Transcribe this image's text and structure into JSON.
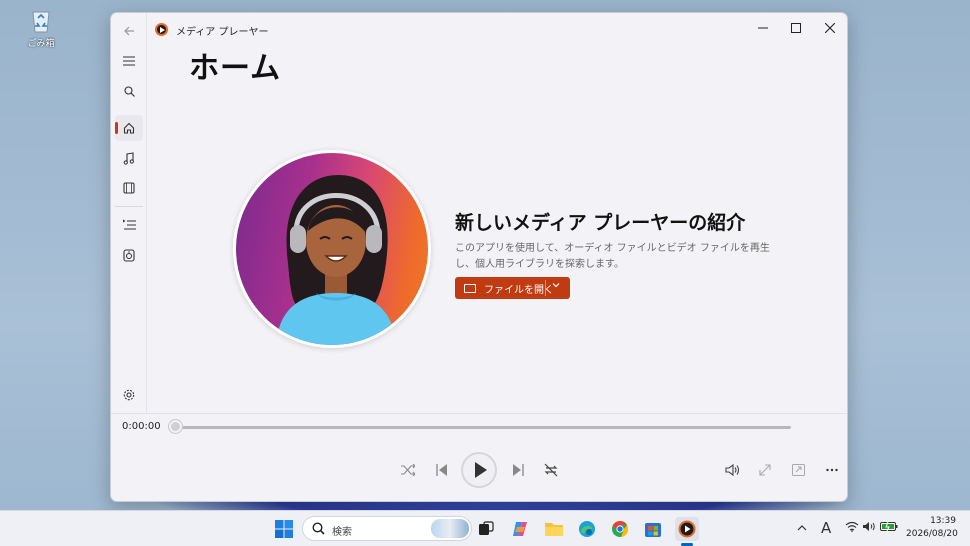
{
  "desktop": {
    "recycle_bin_label": "ごみ箱"
  },
  "window": {
    "app_title": "メディア プレーヤー",
    "buttons": {
      "minimize": "—",
      "maximize": "☐",
      "close": "✕"
    }
  },
  "sidebar": {
    "items": [
      {
        "name": "back",
        "icon": "back-arrow-icon"
      },
      {
        "name": "menu",
        "icon": "hamburger-icon"
      },
      {
        "name": "search",
        "icon": "search-icon"
      },
      {
        "name": "home",
        "icon": "home-icon",
        "active": true
      },
      {
        "name": "music",
        "icon": "music-note-icon"
      },
      {
        "name": "video",
        "icon": "film-icon"
      },
      {
        "name": "playlist",
        "icon": "playlist-icon"
      },
      {
        "name": "play-queue",
        "icon": "speaker-icon"
      },
      {
        "name": "settings",
        "icon": "gear-icon"
      }
    ]
  },
  "main": {
    "page_title": "ホーム",
    "intro_title": "新しいメディア プレーヤーの紹介",
    "intro_desc": "このアプリを使用して、オーディオ ファイルとビデオ ファイルを再生し、個人用ライブラリを探索します。",
    "open_button_label": "ファイルを開く"
  },
  "player": {
    "current_time": "0:00:00",
    "progress": 0,
    "controls": [
      "shuffle-icon",
      "previous-icon",
      "play-icon",
      "next-icon",
      "repeat-off-icon",
      "volume-icon",
      "fullscreen-icon",
      "miniplayer-icon",
      "more-icon"
    ]
  },
  "taskbar": {
    "search_placeholder": "検索",
    "ime_indicator": "A",
    "time": "13:39",
    "date": "2026/08/20",
    "colors": {
      "accent": "#0067c0",
      "media_player_accent": "#c03b12"
    }
  }
}
